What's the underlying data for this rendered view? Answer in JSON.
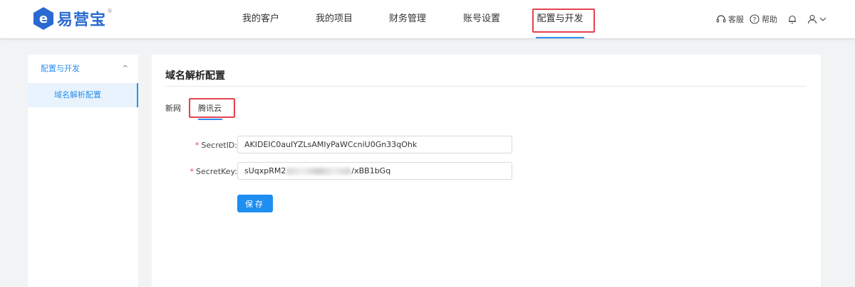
{
  "brand": {
    "name": "易营宝",
    "reg_mark": "®",
    "logo_letter": "e"
  },
  "nav": {
    "items": [
      "我的客户",
      "我的项目",
      "财务管理",
      "账号设置",
      "配置与开发"
    ],
    "active": "配置与开发"
  },
  "tools": {
    "service": "客服",
    "help": "帮助"
  },
  "sidebar": {
    "group_label": "配置与开发",
    "group_chevron": "^",
    "sub_item": "域名解析配置"
  },
  "panel": {
    "title": "域名解析配置",
    "tabs": [
      "新网",
      "腾讯云"
    ],
    "active_tab": "腾讯云"
  },
  "form": {
    "required_mark": "*",
    "secret_id_label": "SecretID:",
    "secret_id_value": "AKIDEIC0auIYZLsAMIyPaWCcniU0Gn33qOhk",
    "secret_key_label": "SecretKey:",
    "secret_key_prefix": "sUqxpRM2",
    "secret_key_suffix": "/xBB1bGq",
    "save_label": "保存"
  },
  "colors": {
    "accent": "#2a8ef0",
    "highlight": "#e5414f",
    "brand": "#2a6ad0"
  }
}
